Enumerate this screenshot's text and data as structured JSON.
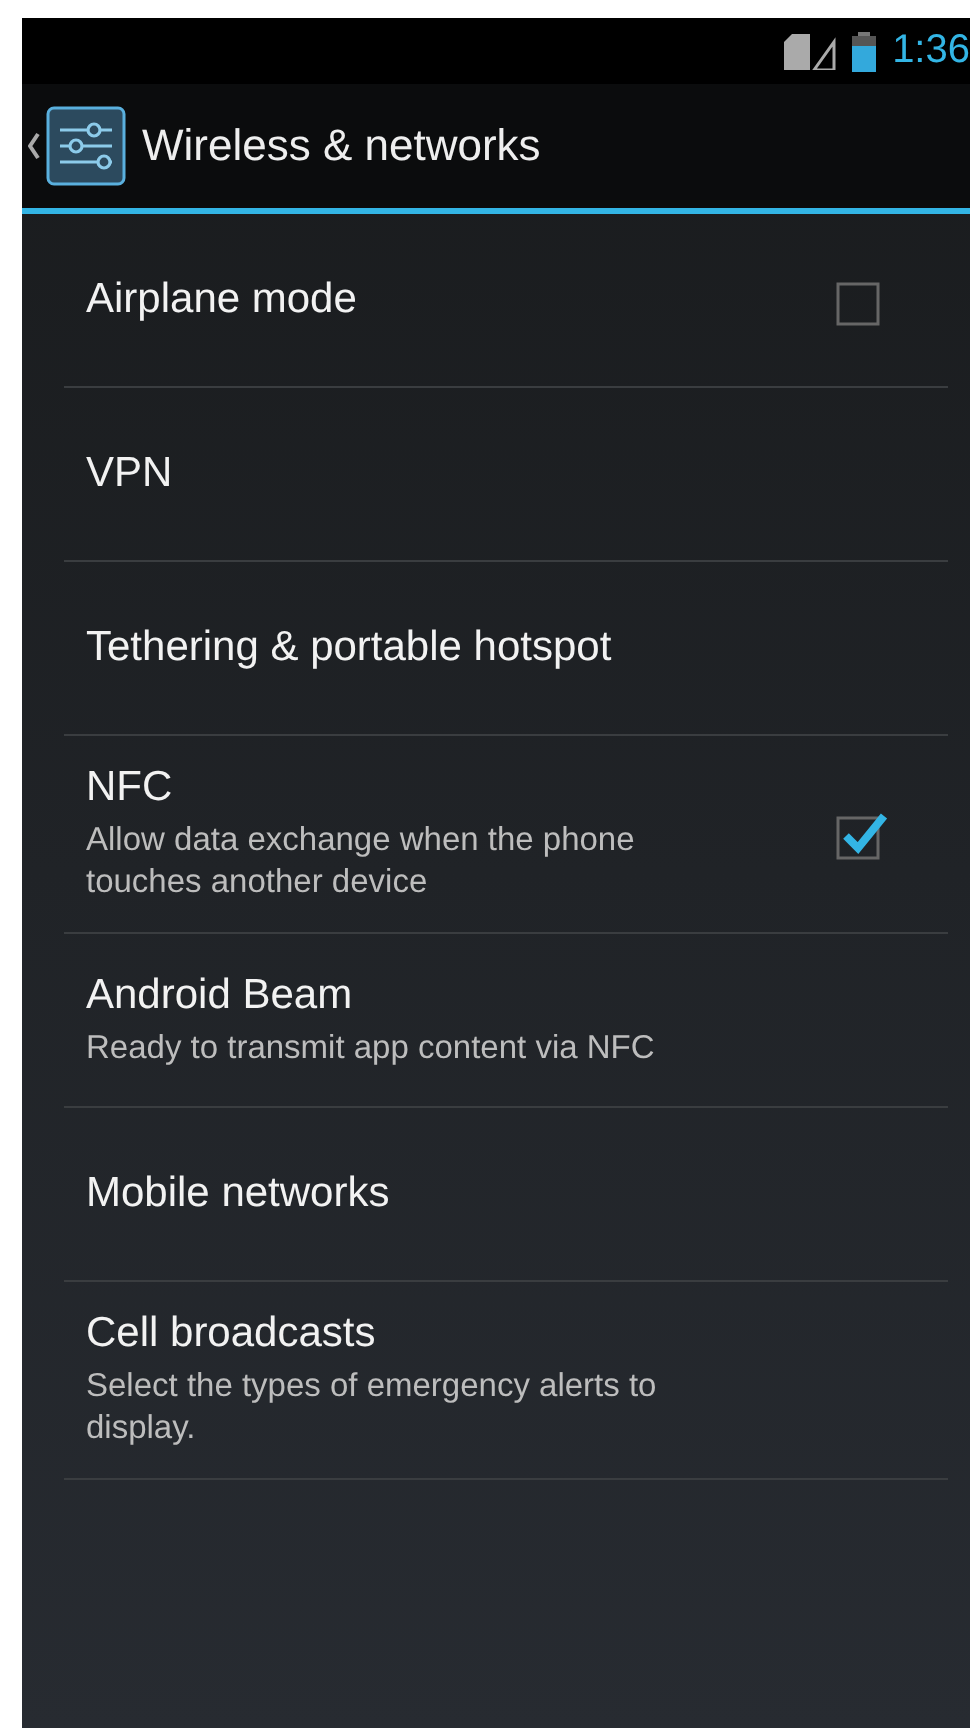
{
  "status_bar": {
    "time": "1:36"
  },
  "action_bar": {
    "title": "Wireless & networks"
  },
  "settings": [
    {
      "kind": "checkbox",
      "title": "Airplane mode",
      "checked": false
    },
    {
      "kind": "plain",
      "title": "VPN"
    },
    {
      "kind": "plain",
      "title": "Tethering & portable hotspot"
    },
    {
      "kind": "checkbox",
      "title": "NFC",
      "summary": "Allow data exchange when the phone touches another device",
      "checked": true
    },
    {
      "kind": "plain",
      "title": "Android Beam",
      "summary": "Ready to transmit app content via NFC"
    },
    {
      "kind": "plain",
      "title": "Mobile networks"
    },
    {
      "kind": "plain",
      "title": "Cell broadcasts",
      "summary": "Select the types of emergency alerts to display."
    }
  ]
}
